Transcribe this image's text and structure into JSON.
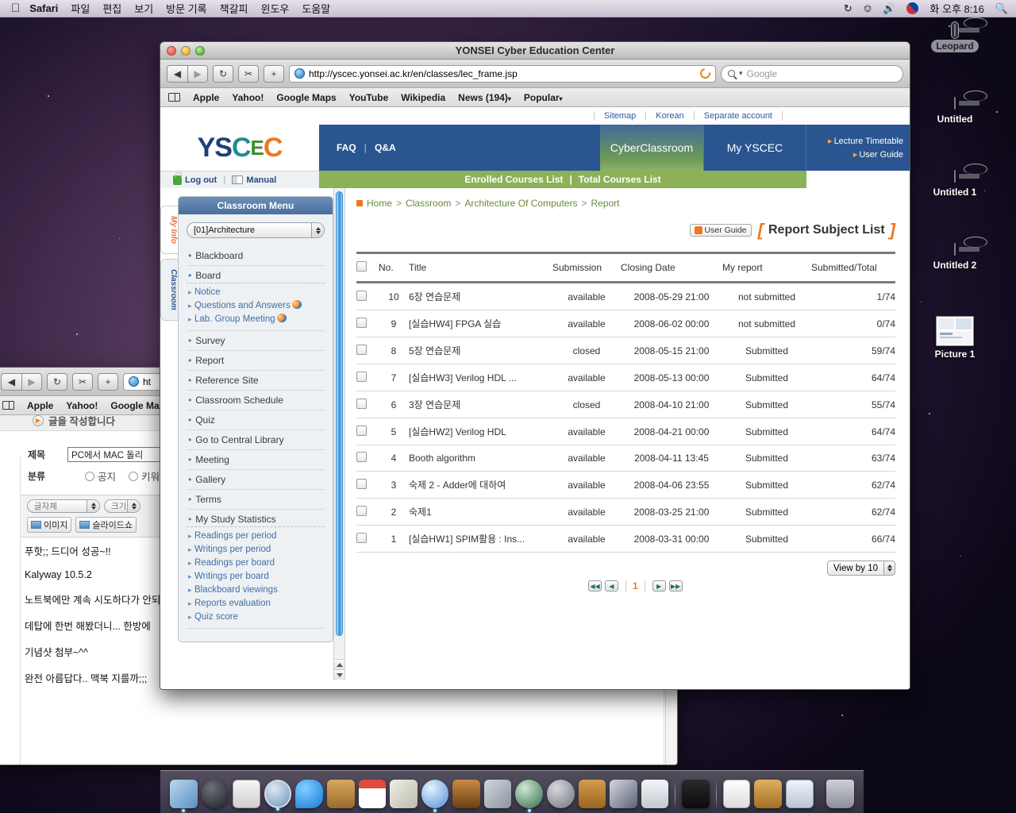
{
  "menubar": {
    "apple_icon": "apple-icon",
    "app_name": "Safari",
    "items": [
      "파일",
      "편집",
      "보기",
      "방문 기록",
      "책갈피",
      "윈도우",
      "도움말"
    ],
    "status": {
      "timemachine_icon": "time-machine-icon",
      "eject_icon": "eject-icon",
      "volume_icon": "volume-icon",
      "input_flag_icon": "korean-flag-icon",
      "clock": "화 오후 8:16",
      "spotlight_icon": "search-icon"
    }
  },
  "desktop_icons": [
    {
      "label": "Leopard",
      "icon": "hard-disk-icon",
      "selected": true
    },
    {
      "label": "Untitled",
      "icon": "hard-disk-icon",
      "selected": false
    },
    {
      "label": "Untitled 1",
      "icon": "hard-disk-icon",
      "selected": false
    },
    {
      "label": "Untitled 2",
      "icon": "hard-disk-icon",
      "selected": false
    },
    {
      "label": "Picture 1",
      "icon": "picture-file-icon",
      "selected": false
    }
  ],
  "background_window": {
    "toolbar": {
      "back_icon": "back-arrow-icon",
      "forward_icon": "forward-arrow-icon",
      "reload_icon": "reload-icon",
      "snip_icon": "snip-icon",
      "add_icon": "plus-icon",
      "url": "ht"
    },
    "bookmarks": [
      "Apple",
      "Yahoo!",
      "Google Ma"
    ],
    "tab_label": "글을 작성합니다",
    "form": {
      "title_label": "제목",
      "title_value": "PC에서 MAC 돌리",
      "category_label": "분류",
      "radio1": "공지",
      "radio2": "키워"
    },
    "editor": {
      "font_select": "글자체",
      "size_select": "크기",
      "image_button": "이미지",
      "slideshow_button": "슬라이드쇼"
    },
    "post_lines": [
      "푸핫;; 드디어 성공~!!",
      "Kalyway 10.5.2",
      "노트북에만 계속 시도하다가 안되",
      "데탑에 한번 해봤더니... 한방에 ",
      "기념샷 첨부~^^",
      "완전 아름답다.. 맥북 지를까;;;"
    ]
  },
  "safari": {
    "window_title": "YONSEI Cyber Education Center",
    "toolbar": {
      "back_icon": "back-arrow-icon",
      "forward_icon": "forward-arrow-icon",
      "reload_icon": "reload-icon",
      "snip_icon": "snip-icon",
      "add_icon": "plus-icon",
      "url": "http://yscec.yonsei.ac.kr/en/classes/lec_frame.jsp",
      "search_placeholder": "Google"
    },
    "bookmarks": [
      "Apple",
      "Yahoo!",
      "Google Maps",
      "YouTube",
      "Wikipedia",
      "News (194)",
      "Popular"
    ]
  },
  "site": {
    "top_links": [
      "Sitemap",
      "Korean",
      "Separate account"
    ],
    "logo": {
      "y": "Y",
      "s": "S",
      "c1": "C",
      "e": "E",
      "c2": "C"
    },
    "nav": {
      "faq": "FAQ",
      "qa": "Q&A",
      "tab_active": "CyberClassroom",
      "tab_second": "My YSCEC",
      "right_links": [
        "Lecture Timetable",
        "User Guide"
      ]
    },
    "actionbar": {
      "logout": "Log out",
      "manual": "Manual",
      "enrolled": "Enrolled Courses List",
      "total": "Total Courses List"
    },
    "vtabs": {
      "my_info": "My Info",
      "classroom": "Classroom"
    },
    "sidebar": {
      "header": "Classroom Menu",
      "course_select": "[01]Architecture",
      "items": [
        {
          "label": "Blackboard"
        },
        {
          "label": "Board",
          "subs": [
            "Notice",
            "Questions and Answers",
            "Lab. Group Meeting"
          ]
        },
        {
          "label": "Survey"
        },
        {
          "label": "Report"
        },
        {
          "label": "Reference Site"
        },
        {
          "label": "Classroom Schedule"
        },
        {
          "label": "Quiz"
        },
        {
          "label": "Go to Central Library"
        },
        {
          "label": "Meeting"
        },
        {
          "label": "Gallery"
        },
        {
          "label": "Terms"
        },
        {
          "label": "My Study Statistics",
          "subs": [
            "Readings per period",
            "Writings per period",
            "Readings per board",
            "Writings per board",
            "Blackboard viewings",
            "Reports evaluation",
            "Quiz score"
          ]
        }
      ]
    },
    "main": {
      "breadcrumb": [
        "Home",
        "Classroom",
        "Architecture Of Computers",
        "Report"
      ],
      "user_guide_button": "User Guide",
      "page_title": "Report Subject List",
      "table": {
        "columns": [
          "No.",
          "Title",
          "Submission",
          "Closing Date",
          "My report",
          "Submitted/Total"
        ],
        "rows": [
          {
            "no": "10",
            "title": "6장 연습문제",
            "submission": "available",
            "closing": "2008-05-29 21:00",
            "myreport": "not submitted",
            "total": "1/74"
          },
          {
            "no": "9",
            "title": "[실습HW4] FPGA 실습",
            "submission": "available",
            "closing": "2008-06-02 00:00",
            "myreport": "not submitted",
            "total": "0/74"
          },
          {
            "no": "8",
            "title": "5장 연습문제",
            "submission": "closed",
            "closing": "2008-05-15 21:00",
            "myreport": "Submitted",
            "total": "59/74"
          },
          {
            "no": "7",
            "title": "[실습HW3] Verilog HDL ...",
            "submission": "available",
            "closing": "2008-05-13 00:00",
            "myreport": "Submitted",
            "total": "64/74"
          },
          {
            "no": "6",
            "title": "3장 연습문제",
            "submission": "closed",
            "closing": "2008-04-10 21:00",
            "myreport": "Submitted",
            "total": "55/74"
          },
          {
            "no": "5",
            "title": "[실습HW2] Verilog HDL",
            "submission": "available",
            "closing": "2008-04-21 00:00",
            "myreport": "Submitted",
            "total": "64/74"
          },
          {
            "no": "4",
            "title": "Booth algorithm",
            "submission": "available",
            "closing": "2008-04-11 13:45",
            "myreport": "Submitted",
            "total": "63/74"
          },
          {
            "no": "3",
            "title": "숙제 2 - Adder에 대하여",
            "submission": "available",
            "closing": "2008-04-06 23:55",
            "myreport": "Submitted",
            "total": "62/74"
          },
          {
            "no": "2",
            "title": "숙제1",
            "submission": "available",
            "closing": "2008-03-25 21:00",
            "myreport": "Submitted",
            "total": "62/74"
          },
          {
            "no": "1",
            "title": "[실습HW1] SPIM활용 : Ins...",
            "submission": "available",
            "closing": "2008-03-31 00:00",
            "myreport": "Submitted",
            "total": "66/74"
          }
        ]
      },
      "view_by": "View by 10",
      "pagination": {
        "first": "◀◀",
        "prev": "◀",
        "current": "1",
        "next": "▶",
        "last": "▶▶"
      }
    }
  },
  "colors": {
    "nav_blue": "#2a5590",
    "accent_green": "#8cb158",
    "accent_orange": "#ef7620",
    "link_blue": "#1b7fd4",
    "total_orange": "#e8730f",
    "submitted_green": "#2f8f3f"
  },
  "dock": {
    "items": [
      "finder",
      "dashboard",
      "mail",
      "safari",
      "ichat",
      "address-book",
      "ical",
      "iphoto",
      "itunes",
      "photobooth",
      "spaces",
      "time-machine",
      "system-preferences",
      "stickies",
      "sketch",
      "numbers",
      "xcode",
      "preview-pdf",
      "package",
      "web-page",
      "trash"
    ]
  }
}
